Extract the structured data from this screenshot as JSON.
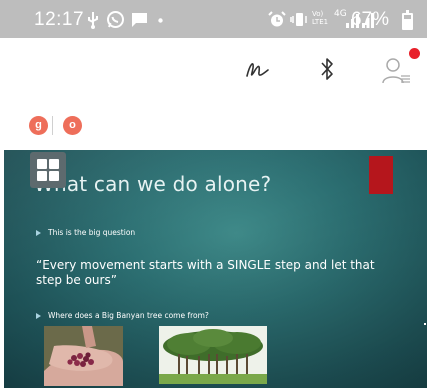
{
  "status_bar": {
    "time": "12:17",
    "network_volte": "Vo) LTE1",
    "network_4g": "4G",
    "battery_percent": "67%",
    "battery_level": 0.67,
    "icons": [
      "usb-icon",
      "whatsapp-icon",
      "chat-icon",
      "dot-icon",
      "alarm-icon",
      "vibrate-icon",
      "volte-icon",
      "4g-icon",
      "signal-icon",
      "signal-icon-2",
      "battery-icon"
    ]
  },
  "toolbar": {
    "icons": [
      "annotate-icon",
      "bluetooth-icon",
      "participants-icon"
    ],
    "notification_color": "#e8202a"
  },
  "participants": {
    "items": [
      {
        "label": "g",
        "color": "#ee6e5a"
      },
      {
        "label": "o",
        "color": "#ee6e5a"
      }
    ]
  },
  "slide": {
    "title": "What can we do alone?",
    "bullet_1": "This is the big question",
    "quote": "“Every movement starts with a SINGLE step and let that step be ours”",
    "bullet_2": "Where does a Big Banyan tree come from?",
    "accent_color": "#b5161c"
  }
}
